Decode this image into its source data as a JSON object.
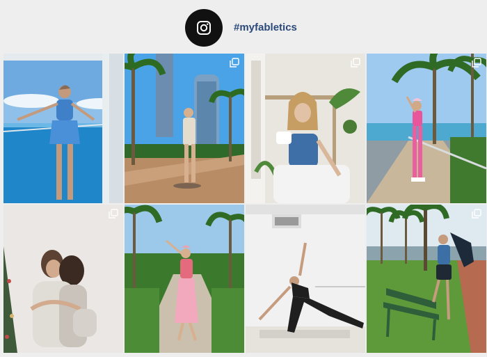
{
  "profile": {
    "hashtag": "#myfabletics",
    "icon": "instagram-icon",
    "badge_color": "#111111",
    "link_color": "#2b4a7a"
  },
  "grid": {
    "posts": [
      {
        "scene": "woman-blue-outfit-infinity-pool",
        "multiple": false
      },
      {
        "scene": "woman-walking-palm-trees-city",
        "multiple": true
      },
      {
        "scene": "woman-blue-top-holding-mug",
        "multiple": true
      },
      {
        "scene": "woman-pink-set-boardwalk-palms",
        "multiple": true
      },
      {
        "scene": "two-women-hugging-christmas-tree",
        "multiple": true
      },
      {
        "scene": "woman-stretching-garden-path",
        "multiple": false
      },
      {
        "scene": "woman-yoga-pose-studio",
        "multiple": false
      },
      {
        "scene": "woman-on-bench-park-palms",
        "multiple": true
      }
    ]
  }
}
